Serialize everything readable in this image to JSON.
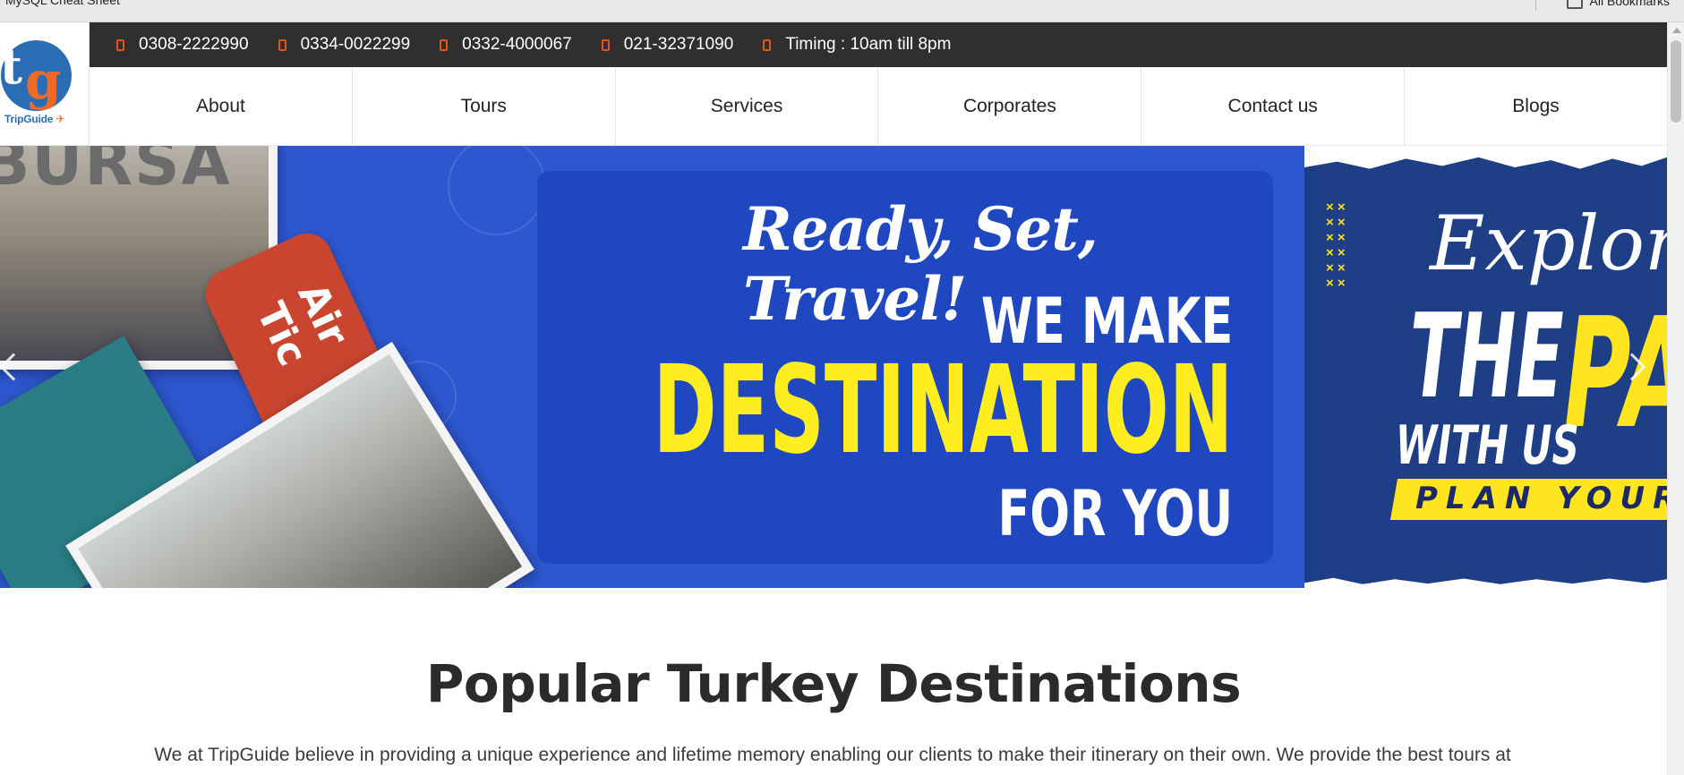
{
  "browser": {
    "bookmark_left": "MySQL Cheat Sheet",
    "bookmark_right": "All Bookmarks"
  },
  "logo": {
    "mark_t": "t",
    "mark_g": "g",
    "brand": "TripGuide"
  },
  "topbar": {
    "items": [
      {
        "label": "0308-2222990",
        "icon": "phone-icon"
      },
      {
        "label": "0334-0022299",
        "icon": "phone-icon"
      },
      {
        "label": "0332-4000067",
        "icon": "phone-icon"
      },
      {
        "label": "021-32371090",
        "icon": "phone-icon"
      },
      {
        "label": "Timing : 10am till 8pm",
        "icon": "clock-icon"
      }
    ],
    "icon_color": "#e8531b"
  },
  "nav": {
    "items": [
      "About",
      "Tours",
      "Services",
      "Corporates",
      "Contact us",
      "Blogs"
    ]
  },
  "hero": {
    "slide1": {
      "sign": "BURSA",
      "ticket": "Air Tic",
      "script": "Ready, Set, Travel!",
      "line1": "WE MAKE",
      "line2": "DESTINATION",
      "line3": "FOR YOU"
    },
    "slide2": {
      "script": "Explore",
      "big1": "THE",
      "big2": "PA",
      "small": "WITH US",
      "band": "PLAN YOUR T"
    },
    "colors": {
      "primary_blue": "#2d57cf",
      "accent_yellow": "#ffee1f"
    }
  },
  "section": {
    "title": "Popular Turkey Destinations",
    "description": "We at TripGuide believe in providing a unique experience and lifetime memory enabling our clients to make their itinerary on their own. We provide the best tours at"
  }
}
